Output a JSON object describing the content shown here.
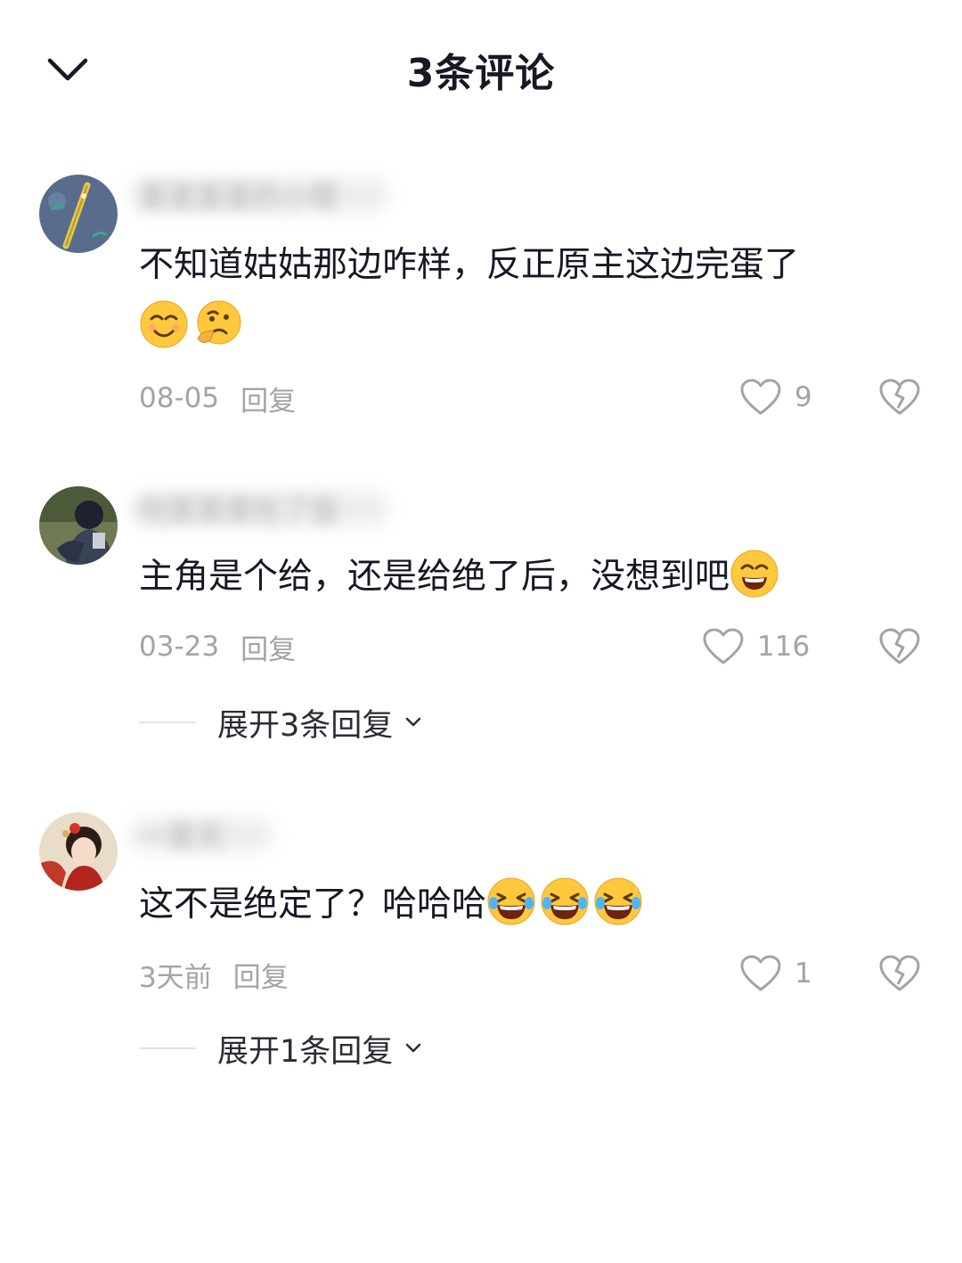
{
  "header": {
    "title": "3条评论"
  },
  "comments": [
    {
      "username": "某某某某的小帮",
      "text": "不知道姑姑那边咋样，反正原主这边完蛋了",
      "date": "08-05",
      "reply_label": "回复",
      "likes": "9"
    },
    {
      "username": "何某某某吃了饭",
      "text": "主角是个给，还是给绝了后，没想到吧",
      "date": "03-23",
      "reply_label": "回复",
      "likes": "116",
      "expand_label": "展开3条回复"
    },
    {
      "username": "一某天",
      "text": "这不是绝定了？哈哈哈",
      "date": "3天前",
      "reply_label": "回复",
      "likes": "1",
      "expand_label": "展开1条回复"
    }
  ],
  "colors": {
    "text_primary": "#161823",
    "text_secondary": "#a3a3a8",
    "emoji_yellow": "#ffc83d"
  }
}
